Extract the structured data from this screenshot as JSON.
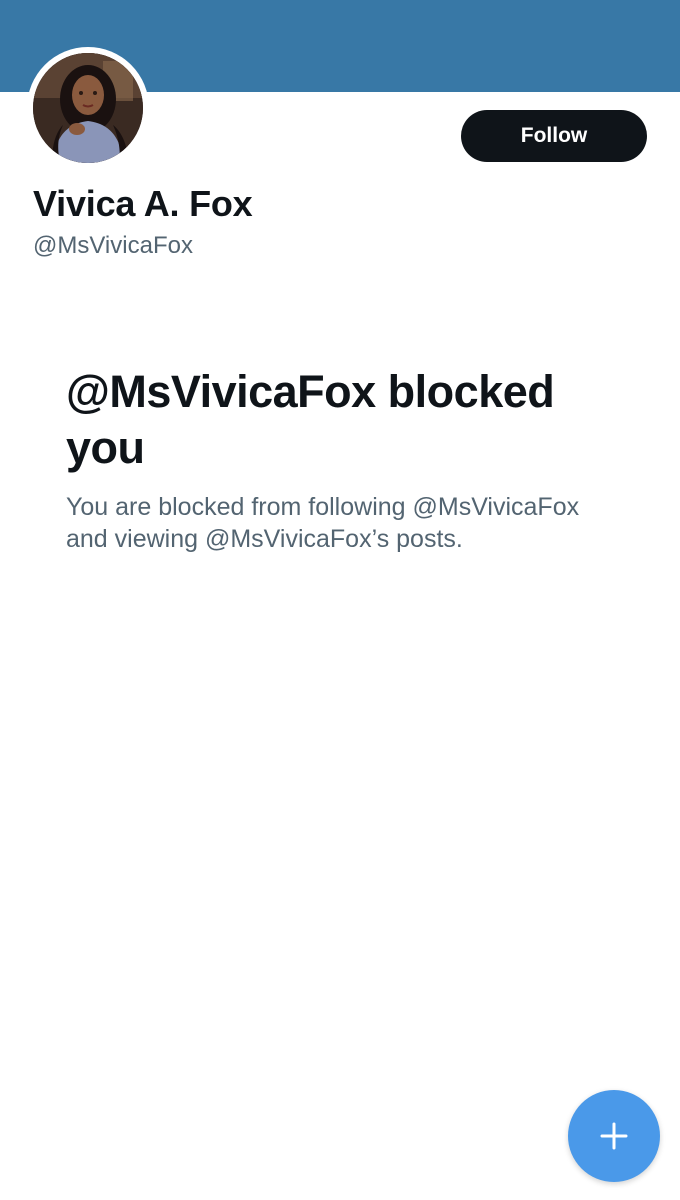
{
  "profile": {
    "banner_color": "#3878a6",
    "avatar_icon": "profile-photo",
    "display_name": "Vivica A. Fox",
    "handle": "@MsVivicaFox",
    "follow_label": "Follow"
  },
  "blocked": {
    "title": "@MsVivicaFox blocked you",
    "description": "You are blocked from following @MsVivicaFox and viewing @MsVivicaFox’s posts."
  },
  "fab": {
    "icon": "plus-icon",
    "color": "#4a99e9"
  }
}
